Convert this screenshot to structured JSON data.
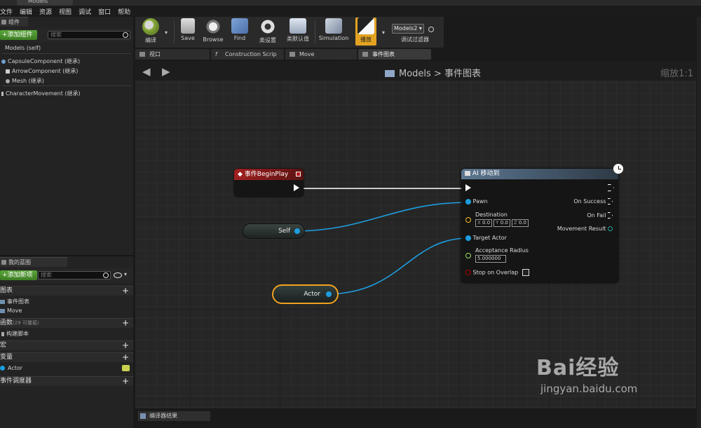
{
  "window": {
    "tab": "Models"
  },
  "menu": [
    "文件",
    "编辑",
    "资源",
    "视图",
    "调试",
    "窗口",
    "帮助"
  ],
  "components_panel": {
    "tab": "组件",
    "add_button": "添加组件",
    "search_placeholder": "搜索",
    "root": "Models (self)",
    "items": [
      "CapsuleComponent (继承)",
      "ArrowComponent (继承)",
      "Mesh (继承)",
      "CharacterMovement (继承)"
    ]
  },
  "my_blueprint_panel": {
    "tab": "我的蓝图",
    "add_button": "添加新项",
    "search_placeholder": "搜索",
    "sections": {
      "graphs": "图表",
      "graph_items": [
        "事件图表",
        "Move"
      ],
      "functions": "函数",
      "functions_note": "(29 可覆载)",
      "function_items": [
        "构建脚本"
      ],
      "macros": "宏",
      "variables": "变量",
      "variable_items": [
        "Actor"
      ],
      "dispatchers": "事件调度器"
    }
  },
  "toolbar": {
    "compile": "编译",
    "save": "Save",
    "browse": "Browse",
    "find": "Find",
    "class_settings": "类设置",
    "class_defaults": "类默认值",
    "simulation": "Simulation",
    "play": "播放",
    "debug_object": "Models2",
    "debug_filter": "调试过滤器"
  },
  "editor_tabs": [
    "视口",
    "Construction Scrip",
    "Move",
    "事件图表"
  ],
  "graph": {
    "breadcrumb_root": "Models",
    "breadcrumb_sep": ">",
    "breadcrumb_current": "事件图表",
    "zoom": "缩放1:1",
    "nodes": {
      "begin_play": {
        "title": "事件BeginPlay"
      },
      "self": {
        "label": "Self"
      },
      "actor": {
        "label": "Actor"
      },
      "ai_move": {
        "title": "AI 移动到",
        "pawn": "Pawn",
        "destination": "Destination",
        "dest_x": "0.0",
        "dest_y": "0.0",
        "dest_z": "0.0",
        "target_actor": "Target Actor",
        "acceptance_radius": "Acceptance Radius",
        "acceptance_value": "5.000000",
        "stop_on_overlap": "Stop on Overlap",
        "on_success": "On Success",
        "on_fail": "On Fail",
        "movement_result": "Movement Result"
      }
    }
  },
  "bottom_tab": "编译器结果",
  "watermark": {
    "brand": "Bai经验",
    "url": "jingyan.baidu.com"
  },
  "colors": {
    "accent_play": "#e3a321",
    "green_button": "#4b942c",
    "object_pin": "#1d9ee0",
    "vector_pin": "#f0c020",
    "float_pin": "#9be060",
    "bool_pin": "#b00000",
    "event_header": "#8c1c1c"
  }
}
